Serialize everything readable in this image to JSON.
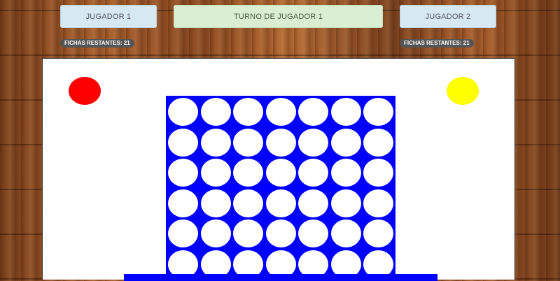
{
  "header": {
    "player1_label": "JUGADOR 1",
    "turn_label": "TURNO DE JUGADOR 1",
    "player2_label": "JUGADOR 2"
  },
  "player1": {
    "remaining_text": "FICHAS RESTANTES: 21",
    "remaining": 21,
    "color": "#ff0000"
  },
  "player2": {
    "remaining_text": "FICHAS RESTANTES: 21",
    "remaining": 21,
    "color": "#ffff00"
  },
  "board": {
    "rows": 6,
    "cols": 7,
    "color": "#0000ff",
    "empty_color": "#ffffff",
    "cells": [
      [
        "empty",
        "empty",
        "empty",
        "empty",
        "empty",
        "empty",
        "empty"
      ],
      [
        "empty",
        "empty",
        "empty",
        "empty",
        "empty",
        "empty",
        "empty"
      ],
      [
        "empty",
        "empty",
        "empty",
        "empty",
        "empty",
        "empty",
        "empty"
      ],
      [
        "empty",
        "empty",
        "empty",
        "empty",
        "empty",
        "empty",
        "empty"
      ],
      [
        "empty",
        "empty",
        "empty",
        "empty",
        "empty",
        "empty",
        "empty"
      ],
      [
        "empty",
        "empty",
        "empty",
        "empty",
        "empty",
        "empty",
        "empty"
      ]
    ]
  }
}
